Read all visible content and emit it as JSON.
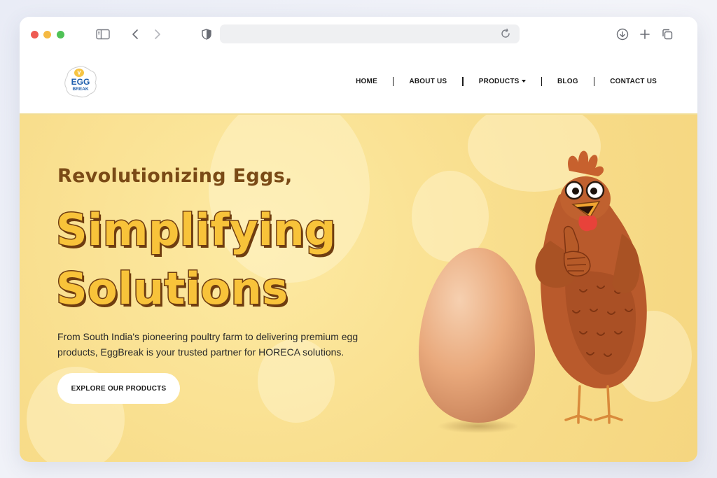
{
  "browser": {
    "controls": [
      "close",
      "minimize",
      "maximize"
    ],
    "icons": [
      "sidebar-icon",
      "back-icon",
      "forward-icon",
      "shield-icon",
      "reload-icon",
      "download-icon",
      "new-tab-icon",
      "tabs-overview-icon"
    ],
    "url": ""
  },
  "site": {
    "logo": {
      "line1": "EGG",
      "line2": "BREAK"
    },
    "nav": {
      "home": "HOME",
      "about": "ABOUT US",
      "products": "PRODUCTS",
      "blog": "BLOG",
      "contact": "CONTACT US"
    }
  },
  "hero": {
    "subtitle": "Revolutionizing Eggs,",
    "title_line1": "Simplifying",
    "title_line2": "Solutions",
    "description": "From South India's pioneering poultry farm to delivering premium egg products, EggBreak is your trusted partner for HORECA solutions.",
    "cta_label": "EXPLORE OUR PRODUCTS"
  },
  "colors": {
    "hero_bg": "#f8dd8b",
    "heading_brown": "#7a4a16",
    "title_yellow": "#f8c33a",
    "title_outline": "#6f3d10",
    "logo_blue": "#1f5fae"
  }
}
